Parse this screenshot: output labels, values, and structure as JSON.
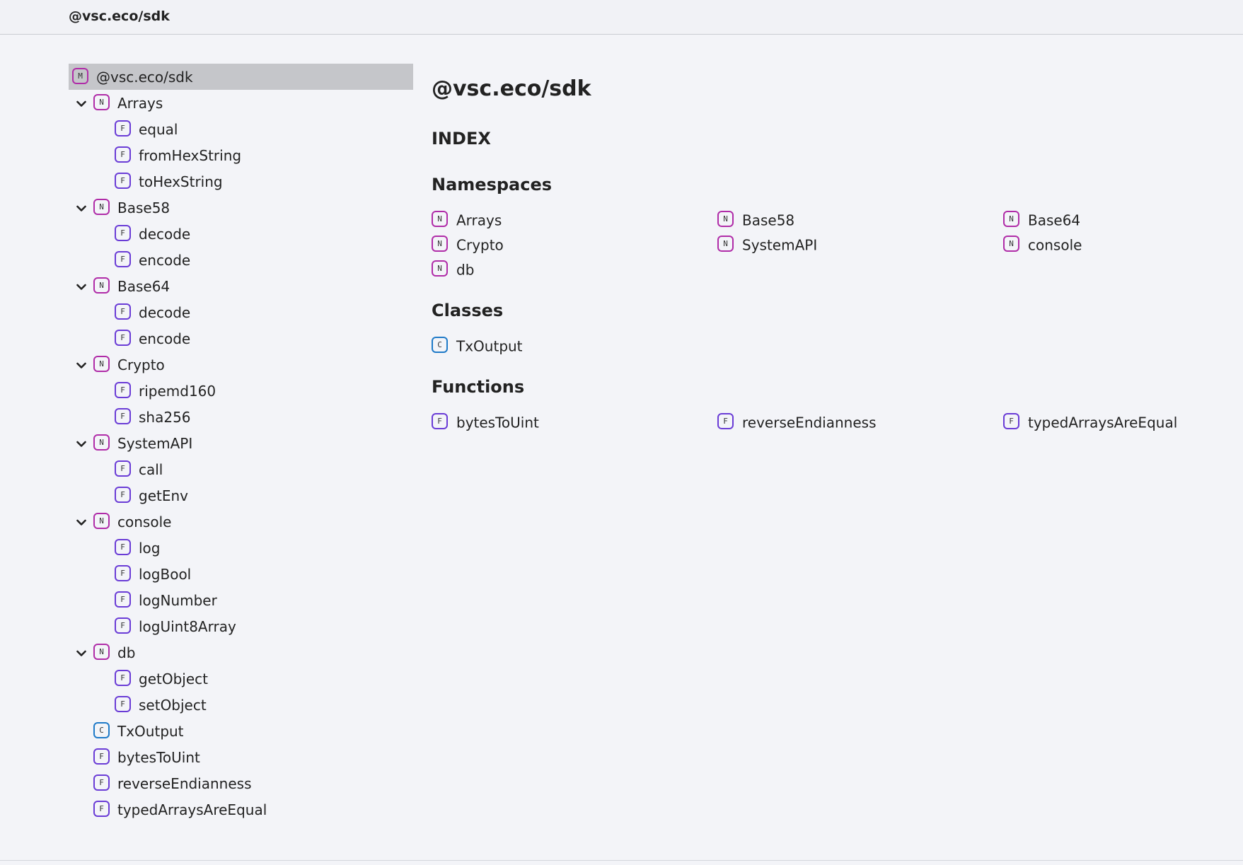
{
  "header": {
    "title": "@vsc.eco/sdk"
  },
  "colors": {
    "namespace": "#b02ca8",
    "function": "#6a3cd6",
    "class": "#1f7ac8",
    "module": "#b02ca8"
  },
  "sidebar": {
    "root": {
      "kind": "M",
      "label": "@vsc.eco/sdk"
    },
    "nodes": [
      {
        "kind": "N",
        "label": "Arrays",
        "children": [
          {
            "kind": "F",
            "label": "equal"
          },
          {
            "kind": "F",
            "label": "fromHexString"
          },
          {
            "kind": "F",
            "label": "toHexString"
          }
        ]
      },
      {
        "kind": "N",
        "label": "Base58",
        "children": [
          {
            "kind": "F",
            "label": "decode"
          },
          {
            "kind": "F",
            "label": "encode"
          }
        ]
      },
      {
        "kind": "N",
        "label": "Base64",
        "children": [
          {
            "kind": "F",
            "label": "decode"
          },
          {
            "kind": "F",
            "label": "encode"
          }
        ]
      },
      {
        "kind": "N",
        "label": "Crypto",
        "children": [
          {
            "kind": "F",
            "label": "ripemd160"
          },
          {
            "kind": "F",
            "label": "sha256"
          }
        ]
      },
      {
        "kind": "N",
        "label": "SystemAPI",
        "children": [
          {
            "kind": "F",
            "label": "call"
          },
          {
            "kind": "F",
            "label": "getEnv"
          }
        ]
      },
      {
        "kind": "N",
        "label": "console",
        "children": [
          {
            "kind": "F",
            "label": "log"
          },
          {
            "kind": "F",
            "label": "logBool"
          },
          {
            "kind": "F",
            "label": "logNumber"
          },
          {
            "kind": "F",
            "label": "logUint8Array"
          }
        ]
      },
      {
        "kind": "N",
        "label": "db",
        "children": [
          {
            "kind": "F",
            "label": "getObject"
          },
          {
            "kind": "F",
            "label": "setObject"
          }
        ]
      },
      {
        "kind": "C",
        "label": "TxOutput"
      },
      {
        "kind": "F",
        "label": "bytesToUint"
      },
      {
        "kind": "F",
        "label": "reverseEndianness"
      },
      {
        "kind": "F",
        "label": "typedArraysAreEqual"
      }
    ]
  },
  "main": {
    "title": "@vsc.eco/sdk",
    "index_heading": "INDEX",
    "sections": [
      {
        "heading": "Namespaces",
        "items": [
          {
            "kind": "N",
            "label": "Arrays"
          },
          {
            "kind": "N",
            "label": "Base58"
          },
          {
            "kind": "N",
            "label": "Base64"
          },
          {
            "kind": "N",
            "label": "Crypto"
          },
          {
            "kind": "N",
            "label": "SystemAPI"
          },
          {
            "kind": "N",
            "label": "console"
          },
          {
            "kind": "N",
            "label": "db"
          }
        ]
      },
      {
        "heading": "Classes",
        "items": [
          {
            "kind": "C",
            "label": "TxOutput"
          }
        ]
      },
      {
        "heading": "Functions",
        "items": [
          {
            "kind": "F",
            "label": "bytesToUint"
          },
          {
            "kind": "F",
            "label": "reverseEndianness"
          },
          {
            "kind": "F",
            "label": "typedArraysAreEqual"
          }
        ]
      }
    ]
  }
}
